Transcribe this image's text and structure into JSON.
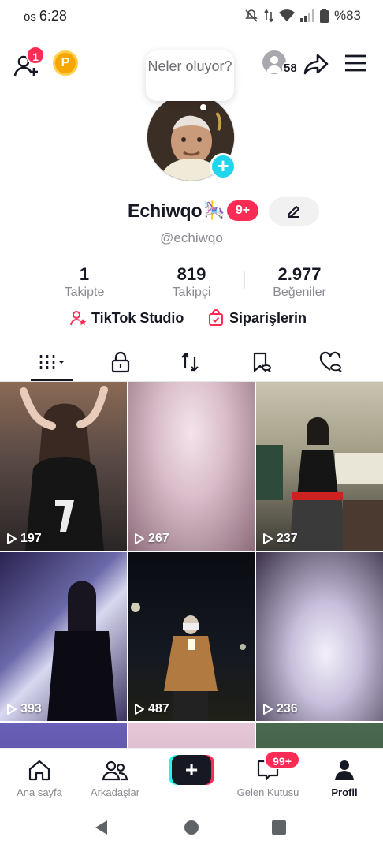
{
  "status_bar": {
    "time_prefix": "ös",
    "time": "6:28",
    "battery": "%83",
    "icons": [
      "mute-icon",
      "data-arrows-icon",
      "wifi-icon",
      "signal-icon",
      "battery-icon"
    ]
  },
  "top_bar": {
    "add_friend_icon": "add-friend-icon",
    "friend_requests_badge": "1",
    "coin_label": "P",
    "profile_viewers_count": "58",
    "share_icon": "share-icon",
    "menu_icon": "hamburger-menu-icon"
  },
  "status_bubble": {
    "text": "Neler oluyor?"
  },
  "profile": {
    "display_name": "Echiwqo",
    "name_emoji": "🎠",
    "level_badge": "9+",
    "username": "@echiwqo",
    "stats": [
      {
        "value": "1",
        "label": "Takipte"
      },
      {
        "value": "819",
        "label": "Takipçi"
      },
      {
        "value": "2.977",
        "label": "Beğeniler"
      }
    ],
    "links": [
      {
        "label": "TikTok Studio",
        "icon": "studio-person-icon"
      },
      {
        "label": "Siparişlerin",
        "icon": "shopping-bag-icon"
      }
    ]
  },
  "tabs": [
    {
      "name": "videos",
      "icon": "grid-icon",
      "active": true
    },
    {
      "name": "private",
      "icon": "lock-icon",
      "active": false
    },
    {
      "name": "reposts",
      "icon": "repost-icon",
      "active": false
    },
    {
      "name": "favorites",
      "icon": "bookmark-hidden-icon",
      "active": false
    },
    {
      "name": "liked",
      "icon": "heart-hidden-icon",
      "active": false
    }
  ],
  "videos": [
    {
      "views": "197"
    },
    {
      "views": "267"
    },
    {
      "views": "237"
    },
    {
      "views": "393"
    },
    {
      "views": "487"
    },
    {
      "views": "236"
    }
  ],
  "bottom_nav": [
    {
      "label": "Ana sayfa",
      "icon": "home-icon",
      "active": false
    },
    {
      "label": "Arkadaşlar",
      "icon": "friends-icon",
      "active": false
    },
    {
      "label": "",
      "icon": "create-plus-icon",
      "active": false
    },
    {
      "label": "Gelen Kutusu",
      "icon": "inbox-icon",
      "active": false,
      "badge": "99+"
    },
    {
      "label": "Profil",
      "icon": "profile-icon",
      "active": true
    }
  ],
  "colors": {
    "accent_red": "#fe2c55",
    "accent_cyan": "#25f4ee",
    "text_primary": "#161823",
    "text_secondary": "#8a8b91"
  }
}
